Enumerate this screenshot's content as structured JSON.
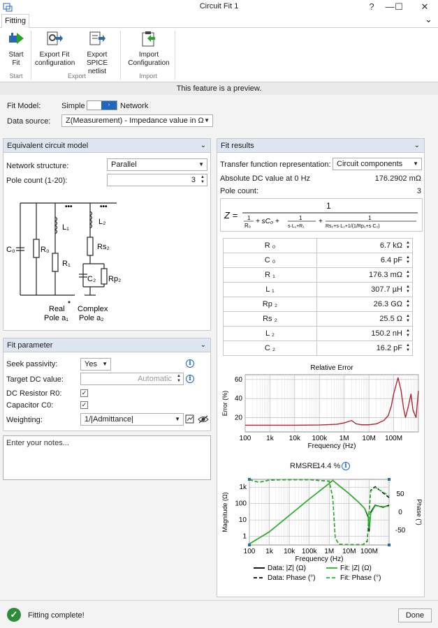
{
  "window": {
    "title": "Circuit Fit 1",
    "help_glyph": "?",
    "min_glyph": "—",
    "max_glyph": "☐",
    "close_glyph": "✕"
  },
  "ribbon": {
    "tab": "Fitting",
    "collapse_glyph": "⌄",
    "buttons": {
      "start_fit": "Start Fit",
      "export_fit_config": "Export Fit configuration",
      "export_spice": "Export SPICE netlist",
      "import_config": "Import Configuration"
    },
    "groups": {
      "start": "Start",
      "export": "Export",
      "import": "Import"
    }
  },
  "preview_banner": "This feature is a preview.",
  "fit_model": {
    "label": "Fit Model:",
    "left": "Simple",
    "right": "Network",
    "knob": "›"
  },
  "data_source": {
    "label": "Data source:",
    "value": "Z(Measurement) - Impedance value in Ω",
    "arrow": "▼"
  },
  "equiv": {
    "title": "Equivalent circuit model",
    "chevron": "⌄",
    "network_structure": {
      "label": "Network structure:",
      "value": "Parallel"
    },
    "pole_count": {
      "label": "Pole count (1-20):",
      "value": "3"
    },
    "schematic": {
      "c0": "C₀",
      "r0": "R₀",
      "l1": "L₁",
      "r1": "R₁",
      "l2": "L₂",
      "rs2": "Rs₂",
      "c2": "C₂",
      "rp2": "Rp₂",
      "dots": "•••",
      "real_pole_1": "Real",
      "real_pole_2": "Pole a₁",
      "complex_pole_1": "Complex",
      "complex_pole_2": "Pole a₂"
    }
  },
  "fit_param": {
    "title": "Fit parameter",
    "chevron": "⌄",
    "seek_passivity": {
      "label": "Seek passivity:",
      "value": "Yes"
    },
    "target_dc": {
      "label": "Target DC value:",
      "placeholder": "Automatic"
    },
    "dc_resistor": {
      "label": "DC Resistor R0:",
      "checked": "✓"
    },
    "capacitor_c0": {
      "label": "Capacitor C0:",
      "checked": "✓"
    },
    "weighting": {
      "label": "Weighting:",
      "value": "1/|Admittance|"
    },
    "info_glyph": "i"
  },
  "notes": {
    "placeholder": "Enter your notes..."
  },
  "fit_results": {
    "title": "Fit results",
    "chevron": "⌄",
    "tf_repr": {
      "label": "Transfer function representation:",
      "value": "Circuit components"
    },
    "abs_dc": {
      "label": "Absolute DC value at 0 Hz",
      "value": "176.2902 mΩ"
    },
    "pole_count": {
      "label": "Pole count:",
      "value": "3"
    },
    "formula": {
      "z": "Z =",
      "num": "1",
      "t1n": "1",
      "t1d": "R₀",
      "t2": "+ sC₀ +",
      "t3n": "1",
      "t3d": "s·L₁+R₁",
      "plus": "+",
      "t4n": "1",
      "t4d": "Rs₂+s·L₂+1/(1/Rp₂+s·C₂)"
    },
    "components": [
      {
        "name": "R ₀",
        "value": "6.7 kΩ"
      },
      {
        "name": "C ₀",
        "value": "6.4 pF"
      },
      {
        "name": "R ₁",
        "value": "176.3 mΩ"
      },
      {
        "name": "L ₁",
        "value": "307.7 µH"
      },
      {
        "name": "Rp ₂",
        "value": "26.3 GΩ"
      },
      {
        "name": "Rs ₂",
        "value": "25.5 Ω"
      },
      {
        "name": "L ₂",
        "value": "150.2 nH"
      },
      {
        "name": "C ₂",
        "value": "16.2 pF"
      }
    ],
    "rmsre": {
      "label": "RMSRE:",
      "value": "14.4 %"
    }
  },
  "chart_data": [
    {
      "type": "line",
      "title": "Relative Error",
      "xlabel": "Frequency (Hz)",
      "ylabel": "Error (%)",
      "x_scale": "log",
      "xlim": [
        100,
        1000000000
      ],
      "ylim": [
        5,
        65
      ],
      "xticks": [
        "100",
        "1k",
        "10k",
        "100k",
        "1M",
        "10M",
        "100M"
      ],
      "yticks": [
        "20",
        "40",
        "60"
      ],
      "grid": true,
      "color": "#b22234",
      "x": [
        100,
        1000,
        10000,
        100000,
        500000,
        1000000,
        2000000,
        3000000,
        5000000,
        10000000,
        20000000,
        40000000,
        60000000,
        80000000,
        100000000,
        150000000,
        200000000,
        250000000,
        300000000,
        400000000,
        500000000,
        600000000,
        800000000,
        1000000000
      ],
      "y": [
        12,
        12,
        12,
        12.3,
        13,
        14.5,
        17,
        13.5,
        12.5,
        12.5,
        13.5,
        17,
        22,
        32,
        45,
        62,
        48,
        30,
        20,
        33,
        45,
        28,
        20,
        48
      ]
    },
    {
      "type": "line",
      "title": "",
      "xlabel": "Frequency (Hz)",
      "ylabel": "Magnitude (Ω)",
      "y2label": "Phase (°)",
      "x_scale": "log",
      "y_scale": "log",
      "xlim": [
        100,
        1000000000
      ],
      "ylim": [
        0.3,
        3000
      ],
      "y2lim": [
        -90,
        90
      ],
      "xticks": [
        "100",
        "1k",
        "10k",
        "100k",
        "1M",
        "10M",
        "100M"
      ],
      "yticks": [
        "1",
        "10",
        "100",
        "1k"
      ],
      "y2ticks": [
        "50",
        "0",
        "-50"
      ],
      "grid": true,
      "legend": "bottom",
      "series": [
        {
          "name": "Data: |Z| (Ω)",
          "axis": "left",
          "style": "solid",
          "color": "#000000",
          "x": [
            100,
            1000,
            10000,
            100000,
            1000000,
            1500000,
            3000000,
            10000000,
            30000000,
            60000000,
            90000000,
            100000000,
            120000000,
            200000000,
            500000000,
            1000000000
          ],
          "y": [
            0.35,
            1.9,
            19,
            190,
            1700,
            2600,
            1300,
            400,
            120,
            50,
            15,
            2,
            30,
            80,
            60,
            80
          ]
        },
        {
          "name": "Fit: |Z| (Ω)",
          "axis": "left",
          "style": "solid",
          "color": "#22bb22",
          "x": [
            100,
            1000,
            10000,
            100000,
            1000000,
            1500000,
            3000000,
            10000000,
            30000000,
            60000000,
            90000000,
            100000000,
            120000000,
            200000000,
            500000000,
            1000000000
          ],
          "y": [
            0.35,
            1.9,
            19,
            190,
            1700,
            2600,
            1300,
            400,
            120,
            50,
            18,
            3,
            25,
            75,
            65,
            70
          ]
        },
        {
          "name": "Data: Phase (°)",
          "axis": "right",
          "style": "dashed",
          "color": "#000000",
          "x": [
            100,
            300,
            1000,
            10000,
            100000,
            1000000,
            1500000,
            2000000,
            3000000,
            10000000,
            50000000,
            80000000,
            100000000,
            120000000,
            200000000,
            1000000000
          ],
          "y": [
            89,
            82,
            88,
            89,
            89,
            85,
            40,
            -70,
            -88,
            -89,
            -89,
            -80,
            0,
            60,
            70,
            40
          ]
        },
        {
          "name": "Fit: Phase (°)",
          "axis": "right",
          "style": "dashed",
          "color": "#22bb22",
          "x": [
            100,
            300,
            1000,
            10000,
            100000,
            1000000,
            1500000,
            2000000,
            3000000,
            10000000,
            50000000,
            80000000,
            100000000,
            120000000,
            200000000,
            1000000000
          ],
          "y": [
            89,
            82,
            88,
            89,
            89,
            85,
            40,
            -70,
            -88,
            -89,
            -89,
            -78,
            5,
            58,
            68,
            45
          ]
        }
      ]
    }
  ],
  "status": {
    "check_glyph": "✓",
    "text": "Fitting complete!",
    "done": "Done"
  }
}
